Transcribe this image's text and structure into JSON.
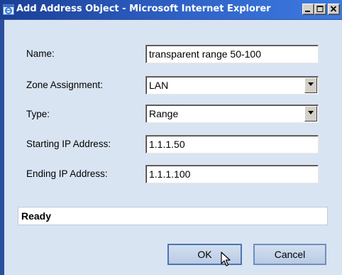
{
  "window": {
    "title": "Add Address Object - Microsoft Internet Explorer",
    "controls": {
      "minimize": "minimize",
      "maximize": "maximize",
      "close": "close"
    }
  },
  "form": {
    "name": {
      "label": "Name:",
      "value": "transparent range 50-100"
    },
    "zone": {
      "label": "Zone Assignment:",
      "value": "LAN"
    },
    "type": {
      "label": "Type:",
      "value": "Range"
    },
    "start_ip": {
      "label": "Starting IP Address:",
      "value": "1.1.1.50"
    },
    "end_ip": {
      "label": "Ending IP Address:",
      "value": "1.1.1.100"
    }
  },
  "status": {
    "text": "Ready"
  },
  "buttons": {
    "ok": "OK",
    "cancel": "Cancel"
  },
  "colors": {
    "titlebar": "#2f63c8",
    "client_bg": "#d9e4f2",
    "button_bg": "#c4d4ea",
    "button_border": "#6f8fc0"
  },
  "icons": {
    "title": "ie-window-icon",
    "dropdown": "chevron-down-icon",
    "cursor": "mouse-pointer-icon"
  }
}
